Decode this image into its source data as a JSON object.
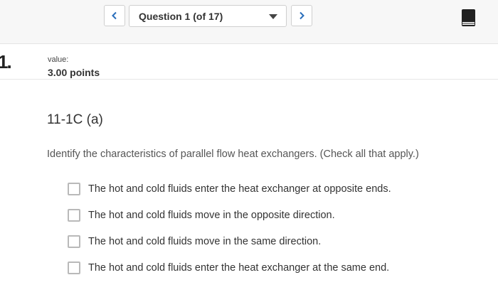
{
  "nav": {
    "question_selector": "Question 1 (of 17)",
    "prev_icon": "chevron-left-icon",
    "next_icon": "chevron-right-icon",
    "ebook_icon": "book-icon",
    "accent": "#2a6ebb"
  },
  "question": {
    "number_glyph": "1.",
    "value_label": "value:",
    "points": "3.00 points",
    "title": "11-1C (a)",
    "prompt": "Identify the characteristics of parallel flow heat exchangers. (Check all that apply.)",
    "options": [
      {
        "label": "The hot and cold fluids enter the heat exchanger at opposite ends.",
        "checked": false
      },
      {
        "label": "The hot and cold fluids move in the opposite direction.",
        "checked": false
      },
      {
        "label": "The hot and cold fluids move in the same direction.",
        "checked": false
      },
      {
        "label": "The hot and cold fluids enter the heat exchanger at the same end.",
        "checked": false
      }
    ]
  }
}
